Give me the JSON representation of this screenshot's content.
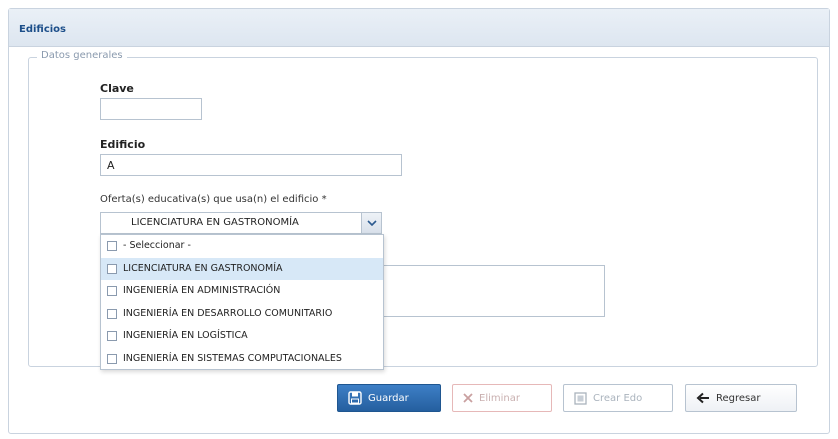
{
  "panel": {
    "title": "Edificios"
  },
  "fieldset": {
    "legend": "Datos generales"
  },
  "form": {
    "clave_label": "Clave",
    "clave_value": "",
    "edificio_label": "Edificio",
    "edificio_value": "A",
    "oferta_label": "Oferta(s) educativa(s) que usa(n) el edificio *",
    "oferta_selected": "LICENCIATURA EN GASTRONOMÍA"
  },
  "dropdown": {
    "options": [
      {
        "label": "- Seleccionar -",
        "checked": false
      },
      {
        "label": "LICENCIATURA EN GASTRONOMÍA",
        "checked": false
      },
      {
        "label": "INGENIERÍA EN ADMINISTRACIÓN",
        "checked": false
      },
      {
        "label": "INGENIERÍA EN DESARROLLO COMUNITARIO",
        "checked": false
      },
      {
        "label": "INGENIERÍA EN LOGÍSTICA",
        "checked": false
      },
      {
        "label": "INGENIERÍA EN SISTEMAS COMPUTACIONALES",
        "checked": false
      }
    ]
  },
  "buttons": {
    "save": "Guardar",
    "delete": "Eliminar",
    "clear": "Crear Edo",
    "back": "Regresar"
  },
  "colors": {
    "primary": "#2b6cb0",
    "header_text": "#1d4f8a",
    "hover_row": "#d7e8f7"
  },
  "icons": {
    "save": "floppy-disk-icon",
    "delete": "x-icon",
    "clear": "window-icon",
    "back": "arrow-left-icon",
    "combo": "chevron-down-icon"
  }
}
